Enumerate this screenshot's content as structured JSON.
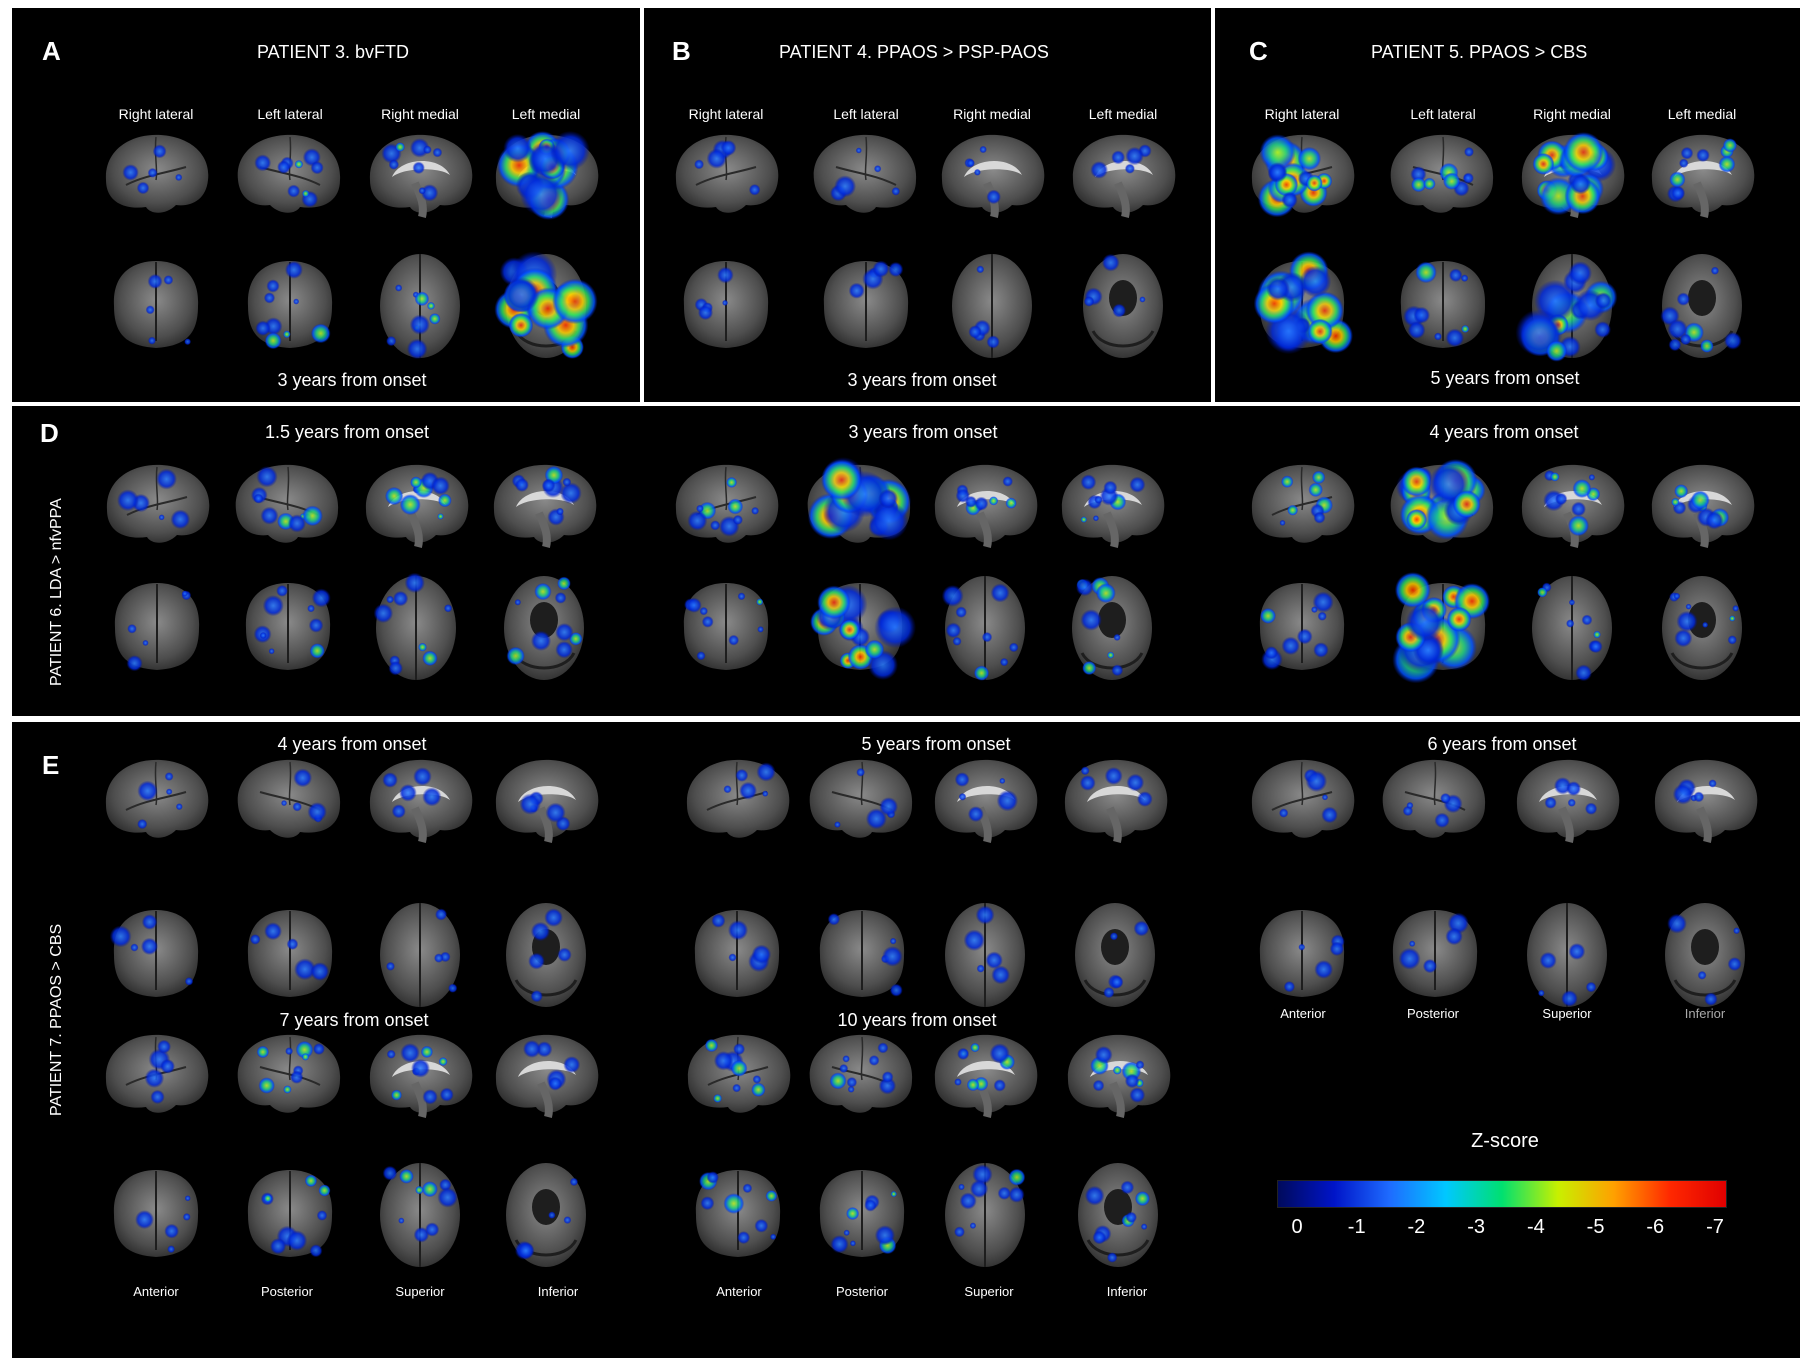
{
  "panels": {
    "A": {
      "letter": "A",
      "title": "PATIENT 3. bvFTD",
      "view_labels": [
        "Right lateral",
        "Left lateral",
        "Right medial",
        "Left medial"
      ],
      "onset": "3 years from onset"
    },
    "B": {
      "letter": "B",
      "title": "PATIENT 4. PPAOS > PSP-PAOS",
      "view_labels": [
        "Right lateral",
        "Left lateral",
        "Right medial",
        "Left medial"
      ],
      "onset": "3 years from onset"
    },
    "C": {
      "letter": "C",
      "title": "PATIENT 5. PPAOS > CBS",
      "view_labels": [
        "Right lateral",
        "Left lateral",
        "Right medial",
        "Left medial"
      ],
      "onset": "5 years from onset"
    },
    "D": {
      "letter": "D",
      "side_label": "PATIENT 6. LDA > nfvPPA",
      "timepoints": [
        "1.5 years from onset",
        "3 years from onset",
        "4 years from onset"
      ]
    },
    "E": {
      "letter": "E",
      "side_label": "PATIENT 7. PPAOS > CBS",
      "timepoints": [
        "4 years from onset",
        "5 years from onset",
        "6 years from onset",
        "7 years from onset",
        "10 years from onset"
      ],
      "bottom_labels": [
        "Anterior",
        "Posterior",
        "Superior",
        "Inferior"
      ]
    }
  },
  "colorbar": {
    "title": "Z-score",
    "ticks": [
      "0",
      "-1",
      "-2",
      "-3",
      "-4",
      "-5",
      "-6",
      "-7"
    ],
    "colors": [
      "#000a5c",
      "#0014c8",
      "#1e6cff",
      "#00c8ff",
      "#00e070",
      "#c8f000",
      "#ffa000",
      "#ff2800",
      "#e00000"
    ]
  },
  "icons": [
    "brain-lateral-icon",
    "brain-medial-icon",
    "brain-anterior-icon",
    "brain-superior-icon",
    "brain-inferior-icon"
  ]
}
